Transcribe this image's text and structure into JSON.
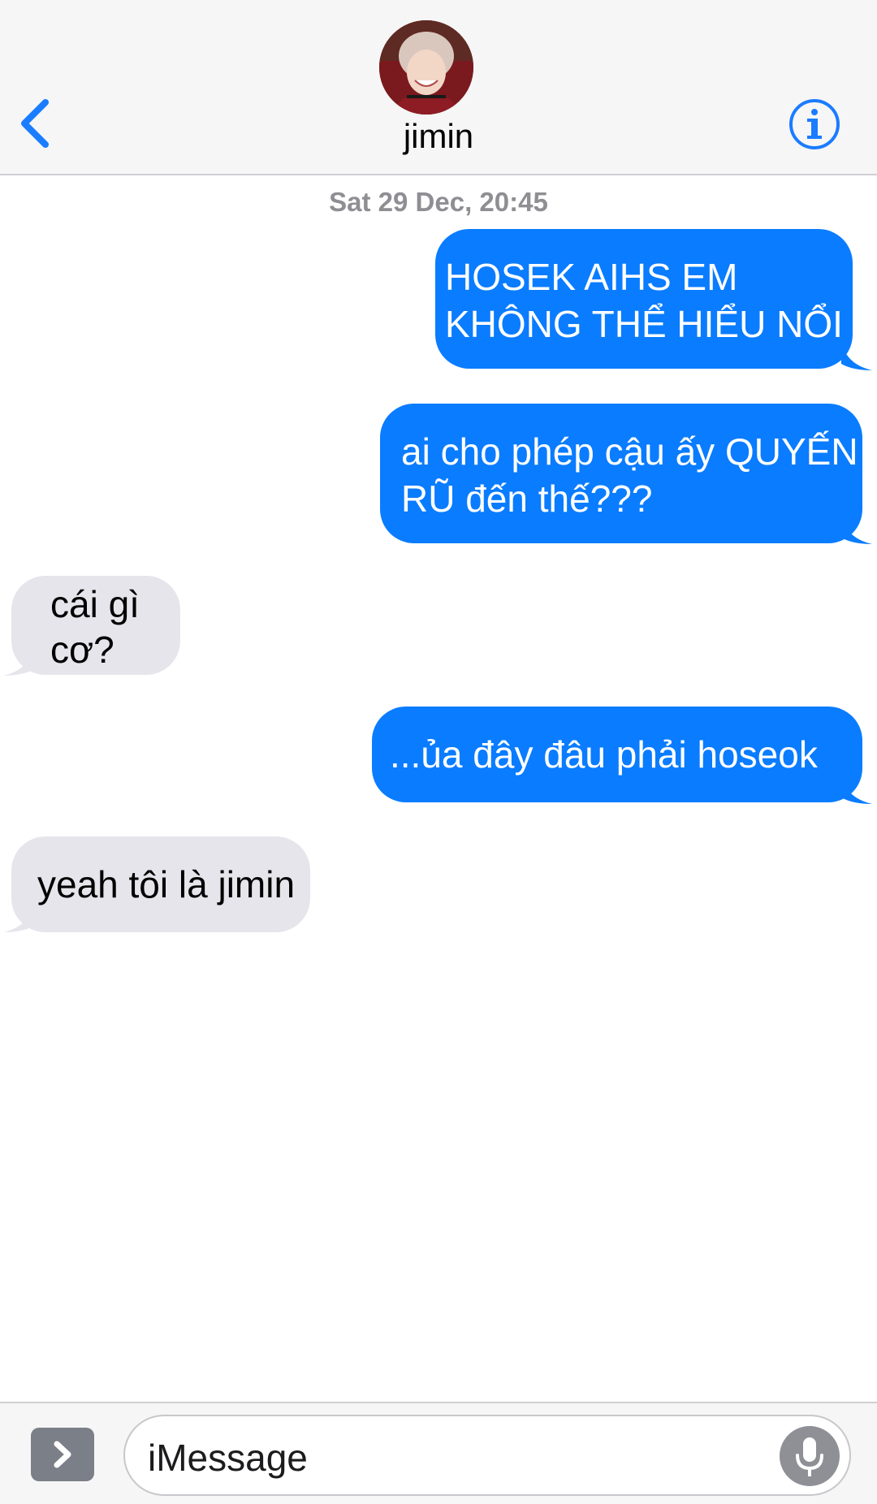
{
  "header": {
    "contact_name": "jimin",
    "back_icon": "chevron-left-icon",
    "info_icon": "info-icon",
    "accent_color": "#1a7cff"
  },
  "conversation": {
    "timestamp": "Sat 29 Dec, 20:45",
    "messages": [
      {
        "direction": "outgoing",
        "lines": [
          "HOSEK AIHS EM",
          "KHÔNG THỂ HIỂU NỔI"
        ]
      },
      {
        "direction": "outgoing",
        "lines": [
          "ai cho phép cậu ấy QUYẾN",
          "RŨ đến thế???"
        ]
      },
      {
        "direction": "incoming",
        "lines": [
          "cái gì",
          "cơ?"
        ]
      },
      {
        "direction": "outgoing",
        "lines": [
          "...ủa đây đâu phải hoseok"
        ]
      },
      {
        "direction": "incoming",
        "lines": [
          "yeah tôi là jimin"
        ]
      }
    ],
    "outgoing_color": "#0a7cff",
    "incoming_color": "#e6e5eb"
  },
  "composer": {
    "placeholder": "iMessage",
    "apps_icon": "chevron-right-icon",
    "mic_icon": "microphone-icon"
  }
}
